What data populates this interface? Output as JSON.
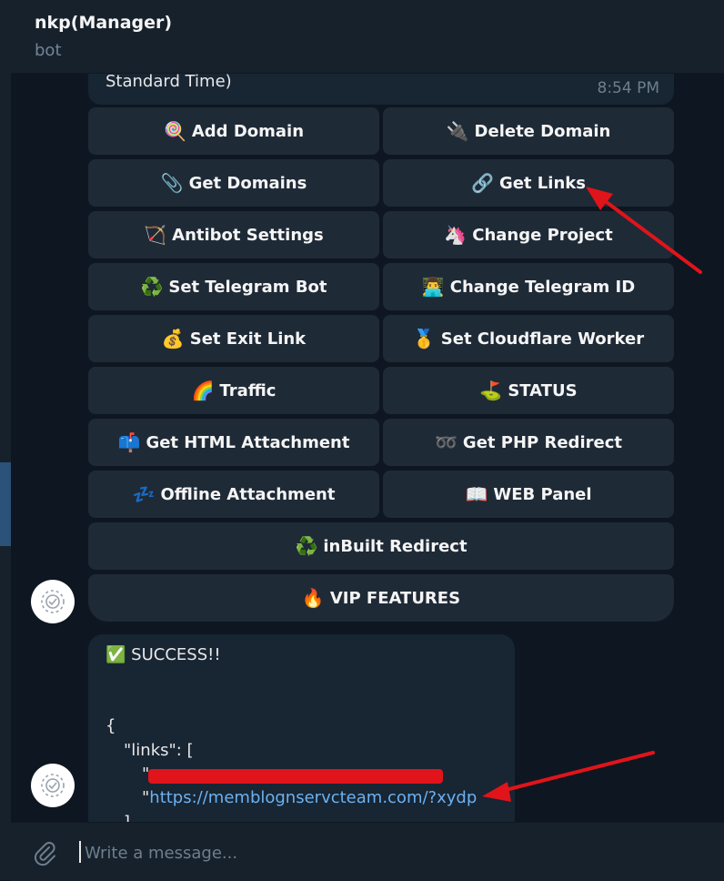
{
  "header": {
    "title": "nkp(Manager)",
    "subtitle": "bot"
  },
  "top_message": {
    "text": "Standard Time)",
    "time": "8:54 PM"
  },
  "keyboard": [
    {
      "label": "Add Domain",
      "icon": "🍭",
      "icon_name": "lollipop-icon"
    },
    {
      "label": "Delete Domain",
      "icon": "🔌",
      "icon_name": "plug-icon"
    },
    {
      "label": "Get Domains",
      "icon": "📎",
      "icon_name": "paperclips-icon"
    },
    {
      "label": "Get Links",
      "icon": "🔗",
      "icon_name": "link-icon"
    },
    {
      "label": "Antibot Settings",
      "icon": "🏹",
      "icon_name": "bow-arrow-icon"
    },
    {
      "label": "Change Project",
      "icon": "🦄",
      "icon_name": "unicorn-icon"
    },
    {
      "label": "Set Telegram Bot",
      "icon": "♻️",
      "icon_name": "recycle-icon"
    },
    {
      "label": "Change Telegram ID",
      "icon": "👨‍💻",
      "icon_name": "technologist-icon"
    },
    {
      "label": "Set Exit Link",
      "icon": "💰",
      "icon_name": "money-bag-icon"
    },
    {
      "label": "Set Cloudflare Worker",
      "icon": "🥇",
      "icon_name": "medal-icon"
    },
    {
      "label": "Traffic",
      "icon": "🌈",
      "icon_name": "rainbow-icon"
    },
    {
      "label": "STATUS",
      "icon": "⛳",
      "icon_name": "flag-icon"
    },
    {
      "label": "Get HTML Attachment",
      "icon": "📫",
      "icon_name": "mailbox-icon"
    },
    {
      "label": "Get PHP Redirect",
      "icon": "➿",
      "icon_name": "loop-icon"
    },
    {
      "label": "Offline Attachment",
      "icon": "💤",
      "icon_name": "zzz-icon"
    },
    {
      "label": "WEB Panel",
      "icon": "📖",
      "icon_name": "book-icon"
    },
    {
      "label": "inBuilt Redirect",
      "icon": "♻️",
      "icon_name": "recycle-icon"
    },
    {
      "label": "VIP FEATURES",
      "icon": "🔥",
      "icon_name": "fire-icon"
    }
  ],
  "result_message": {
    "status_icon": "✅",
    "status_text": "SUCCESS!!",
    "brace_open": "{",
    "links_key": "\"links\": [",
    "quote_1": "\"",
    "quote_2": "\"",
    "link_2": "https://memblognservcteam.com/?xydp",
    "tail": "]"
  },
  "composer": {
    "placeholder": "Write a message..."
  },
  "colors": {
    "background": "#0e1621",
    "panel": "#17212b",
    "bubble": "#182533",
    "button": "#1f2a37",
    "link": "#6ab2f2",
    "annotation_red": "#e0141a"
  }
}
